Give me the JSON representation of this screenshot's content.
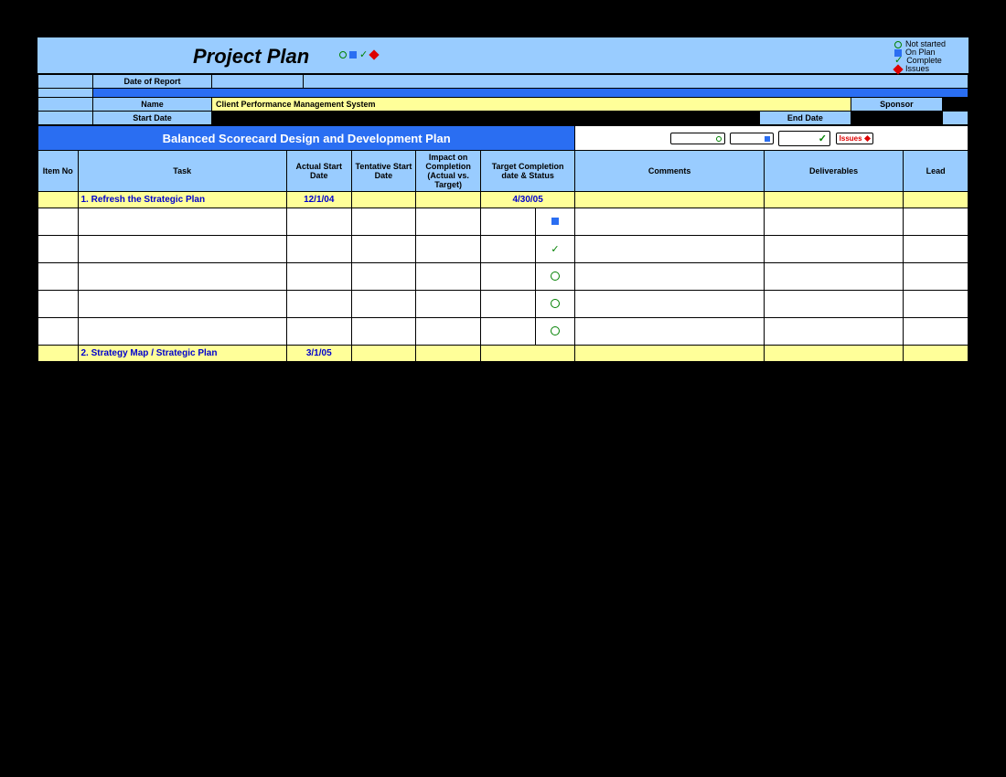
{
  "header": {
    "title": "Project Plan",
    "legend": {
      "not_started": "Not started",
      "on_plan": "On Plan",
      "complete": "Complete",
      "issues": "Issues"
    },
    "date_of_report_label": "Date of Report",
    "name_label": "Name",
    "name_value": "Client Performance Management System",
    "sponsor_label": "Sponsor",
    "start_date_label": "Start Date",
    "end_date_label": "End Date"
  },
  "banner": {
    "title": "Balanced Scorecard Design and Development Plan",
    "pills": {
      "not_started": "Not Started",
      "on_plan": "On Plan",
      "complete": "Complete",
      "issues": "Issues"
    }
  },
  "columns": {
    "item_no": "Item No",
    "task": "Task",
    "actual_start": "Actual Start Date",
    "tentative_start": "Tentative Start Date",
    "impact": "Impact on Completion (Actual vs. Target)",
    "target_completion": "Target Completion date & Status",
    "comments": "Comments",
    "deliverables": "Deliverables",
    "lead": "Lead"
  },
  "sections": [
    {
      "title": "1. Refresh the Strategic Plan",
      "actual_start": "12/1/04",
      "target_completion": "4/30/05",
      "rows": [
        {
          "status": "square"
        },
        {
          "status": "check"
        },
        {
          "status": "circle"
        },
        {
          "status": "circle"
        },
        {
          "status": "circle"
        }
      ]
    },
    {
      "title": "2. Strategy Map / Strategic Plan",
      "actual_start": "3/1/05",
      "target_completion": "",
      "rows": []
    }
  ]
}
